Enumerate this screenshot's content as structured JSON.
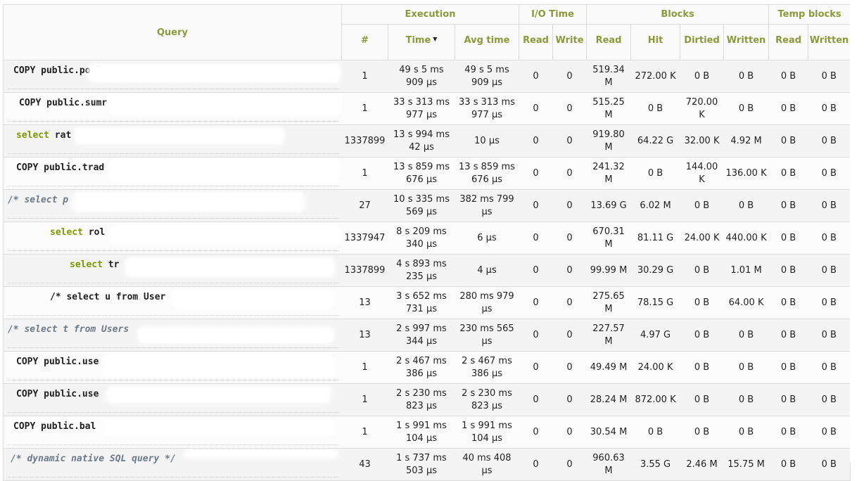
{
  "headers": {
    "query": "Query",
    "execution": "Execution",
    "io_time": "I/O  Time",
    "blocks": "Blocks",
    "temp_blocks": "Temp  blocks",
    "count": "#",
    "time": "Time",
    "avg_time": "Avg  time",
    "io_read": "Read",
    "io_write": "Write",
    "blk_read": "Read",
    "blk_hit": "Hit",
    "blk_dirtied": "Dirtied",
    "blk_written": "Written",
    "tmp_read": "Read",
    "tmp_written": "Written"
  },
  "rows": [
    {
      "query": "COPY public.posi",
      "kw": "",
      "count": "1",
      "time": "49 s 5 ms 909 µs",
      "avg": "49 s 5 ms 909 µs",
      "io_read": "0",
      "io_write": "0",
      "read": "519.34 M",
      "hit": "272.00 K",
      "dirtied": "0 B",
      "written": "0 B",
      "tmp_read": "0 B",
      "tmp_written": "0 B"
    },
    {
      "query": "COPY public.sumr",
      "kw": "",
      "count": "1",
      "time": "33 s 313 ms 977 µs",
      "avg": "33 s 313 ms 977 µs",
      "io_read": "0",
      "io_write": "0",
      "read": "515.25 M",
      "hit": "0 B",
      "dirtied": "720.00 K",
      "written": "0 B",
      "tmp_read": "0 B",
      "tmp_written": "0 B"
    },
    {
      "query": " rat",
      "kw": "select",
      "count": "1337899",
      "time": "13 s 994 ms 42 µs",
      "avg": "10 µs",
      "io_read": "0",
      "io_write": "0",
      "read": "919.80 M",
      "hit": "64.22 G",
      "dirtied": "32.00 K",
      "written": "4.92 M",
      "tmp_read": "0 B",
      "tmp_written": "0 B"
    },
    {
      "query": "COPY public.trad",
      "kw": "",
      "count": "1",
      "time": "13 s 859 ms 676 µs",
      "avg": "13 s 859 ms 676 µs",
      "io_read": "0",
      "io_write": "0",
      "read": "241.32 M",
      "hit": "0 B",
      "dirtied": "144.00 K",
      "written": "136.00 K",
      "tmp_read": "0 B",
      "tmp_written": "0 B"
    },
    {
      "query": "/* select p",
      "kw": "",
      "count": "27",
      "time": "10 s 335 ms 569 µs",
      "avg": "382 ms 799 µs",
      "io_read": "0",
      "io_write": "0",
      "read": "13.69 G",
      "hit": "6.02 M",
      "dirtied": "0 B",
      "written": "0 B",
      "tmp_read": "0 B",
      "tmp_written": "0 B"
    },
    {
      "query": " rol",
      "kw": "select",
      "count": "1337947",
      "time": "8 s 209 ms 340 µs",
      "avg": "6 µs",
      "io_read": "0",
      "io_write": "0",
      "read": "670.31 M",
      "hit": "81.11 G",
      "dirtied": "24.00 K",
      "written": "440.00 K",
      "tmp_read": "0 B",
      "tmp_written": "0 B"
    },
    {
      "query": " tr",
      "kw": "select",
      "count": "1337899",
      "time": "4 s 893 ms 235 µs",
      "avg": "4 µs",
      "io_read": "0",
      "io_write": "0",
      "read": "99.99 M",
      "hit": "30.29 G",
      "dirtied": "0 B",
      "written": "1.01 M",
      "tmp_read": "0 B",
      "tmp_written": "0 B"
    },
    {
      "query": "/* select u from User",
      "kw": "",
      "count": "13",
      "time": "3 s 652 ms 731 µs",
      "avg": "280 ms 979 µs",
      "io_read": "0",
      "io_write": "0",
      "read": "275.65 M",
      "hit": "78.15 G",
      "dirtied": "0 B",
      "written": "64.00 K",
      "tmp_read": "0 B",
      "tmp_written": "0 B"
    },
    {
      "query": "/* select t from Users",
      "kw": "",
      "count": "13",
      "time": "2 s 997 ms 344 µs",
      "avg": "230 ms 565 µs",
      "io_read": "0",
      "io_write": "0",
      "read": "227.57 M",
      "hit": "4.97 G",
      "dirtied": "0 B",
      "written": "0 B",
      "tmp_read": "0 B",
      "tmp_written": "0 B"
    },
    {
      "query": "COPY public.use",
      "kw": "",
      "count": "1",
      "time": "2 s 467 ms 386 µs",
      "avg": "2 s 467 ms 386 µs",
      "io_read": "0",
      "io_write": "0",
      "read": "49.49 M",
      "hit": "24.00 K",
      "dirtied": "0 B",
      "written": "0 B",
      "tmp_read": "0 B",
      "tmp_written": "0 B"
    },
    {
      "query": "COPY public.use",
      "kw": "",
      "count": "1",
      "time": "2 s 230 ms 823 µs",
      "avg": "2 s 230 ms 823 µs",
      "io_read": "0",
      "io_write": "0",
      "read": "28.24 M",
      "hit": "872.00 K",
      "dirtied": "0 B",
      "written": "0 B",
      "tmp_read": "0 B",
      "tmp_written": "0 B"
    },
    {
      "query": "COPY public.bal",
      "kw": "",
      "count": "1",
      "time": "1 s 991 ms 104 µs",
      "avg": "1 s 991 ms 104 µs",
      "io_read": "0",
      "io_write": "0",
      "read": "30.54 M",
      "hit": "0 B",
      "dirtied": "0 B",
      "written": "0 B",
      "tmp_read": "0 B",
      "tmp_written": "0 B"
    },
    {
      "query": "/* dynamic native SQL query */",
      "kw": "",
      "count": "43",
      "time": "1 s 737 ms 503 µs",
      "avg": "40 ms 408 µs",
      "io_read": "0",
      "io_write": "0",
      "read": "960.63 M",
      "hit": "3.55 G",
      "dirtied": "2.46 M",
      "written": "15.75 M",
      "tmp_read": "0 B",
      "tmp_written": "0 B"
    }
  ]
}
